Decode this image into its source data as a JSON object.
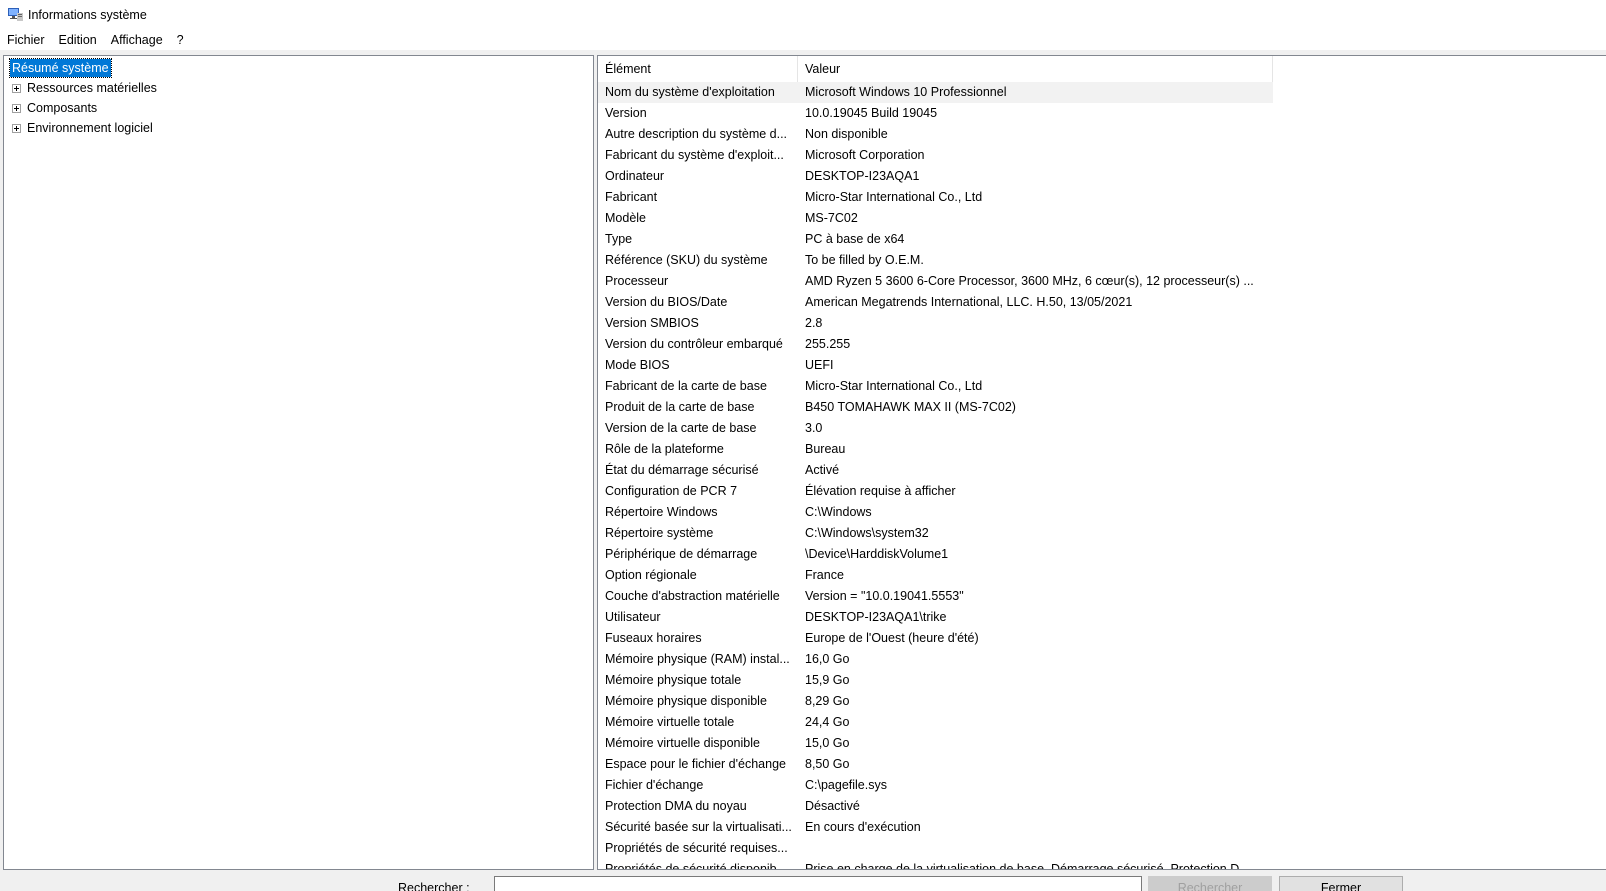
{
  "window": {
    "title": "Informations système"
  },
  "menubar": {
    "items": [
      "Fichier",
      "Edition",
      "Affichage",
      "?"
    ]
  },
  "tree": {
    "root": "Résumé système",
    "children": [
      "Ressources matérielles",
      "Composants",
      "Environnement logiciel"
    ]
  },
  "list": {
    "headers": {
      "element": "Élément",
      "value": "Valeur"
    },
    "rows": [
      {
        "element": "Nom du système d'exploitation",
        "value": "Microsoft Windows 10 Professionnel"
      },
      {
        "element": "Version",
        "value": "10.0.19045 Build 19045"
      },
      {
        "element": "Autre description du système d...",
        "value": "Non disponible"
      },
      {
        "element": "Fabricant du système d'exploit...",
        "value": "Microsoft Corporation"
      },
      {
        "element": "Ordinateur",
        "value": "DESKTOP-I23AQA1"
      },
      {
        "element": "Fabricant",
        "value": "Micro-Star International Co., Ltd"
      },
      {
        "element": "Modèle",
        "value": "MS-7C02"
      },
      {
        "element": "Type",
        "value": "PC à base de x64"
      },
      {
        "element": "Référence (SKU) du système",
        "value": "To be filled by O.E.M."
      },
      {
        "element": "Processeur",
        "value": "AMD Ryzen 5 3600 6-Core Processor, 3600 MHz, 6 cœur(s), 12 processeur(s) ..."
      },
      {
        "element": "Version du BIOS/Date",
        "value": "American Megatrends International, LLC. H.50, 13/05/2021"
      },
      {
        "element": "Version SMBIOS",
        "value": "2.8"
      },
      {
        "element": "Version du contrôleur embarqué",
        "value": "255.255"
      },
      {
        "element": "Mode BIOS",
        "value": "UEFI"
      },
      {
        "element": "Fabricant de la carte de base",
        "value": "Micro-Star International Co., Ltd"
      },
      {
        "element": "Produit de la carte de base",
        "value": "B450 TOMAHAWK MAX II (MS-7C02)"
      },
      {
        "element": "Version de la carte de base",
        "value": "3.0"
      },
      {
        "element": "Rôle de la plateforme",
        "value": "Bureau"
      },
      {
        "element": "État du démarrage sécurisé",
        "value": "Activé"
      },
      {
        "element": "Configuration de PCR 7",
        "value": "Élévation requise à afficher"
      },
      {
        "element": "Répertoire Windows",
        "value": "C:\\Windows"
      },
      {
        "element": "Répertoire système",
        "value": "C:\\Windows\\system32"
      },
      {
        "element": "Périphérique de démarrage",
        "value": "\\Device\\HarddiskVolume1"
      },
      {
        "element": "Option régionale",
        "value": "France"
      },
      {
        "element": "Couche d'abstraction matérielle",
        "value": "Version = \"10.0.19041.5553\""
      },
      {
        "element": "Utilisateur",
        "value": "DESKTOP-I23AQA1\\trike"
      },
      {
        "element": "Fuseaux horaires",
        "value": "Europe de l'Ouest (heure d'été)"
      },
      {
        "element": "Mémoire physique (RAM) instal...",
        "value": "16,0 Go"
      },
      {
        "element": "Mémoire physique totale",
        "value": "15,9 Go"
      },
      {
        "element": "Mémoire physique disponible",
        "value": "8,29 Go"
      },
      {
        "element": "Mémoire virtuelle totale",
        "value": "24,4 Go"
      },
      {
        "element": "Mémoire virtuelle disponible",
        "value": "15,0 Go"
      },
      {
        "element": "Espace pour le fichier d'échange",
        "value": "8,50 Go"
      },
      {
        "element": "Fichier d'échange",
        "value": "C:\\pagefile.sys"
      },
      {
        "element": "Protection DMA du noyau",
        "value": "Désactivé"
      },
      {
        "element": "Sécurité basée sur la virtualisati...",
        "value": "En cours d'exécution"
      },
      {
        "element": "Propriétés de sécurité requises...",
        "value": ""
      },
      {
        "element": "Propriétés de sécurité disponib...",
        "value": "Prise en charge de la virtualisation de base, Démarrage sécurisé, Protection D..."
      }
    ]
  },
  "bottom": {
    "search_label": "Rechercher :",
    "search_value": "",
    "search_button": "Rechercher",
    "close_button": "Fermer"
  }
}
